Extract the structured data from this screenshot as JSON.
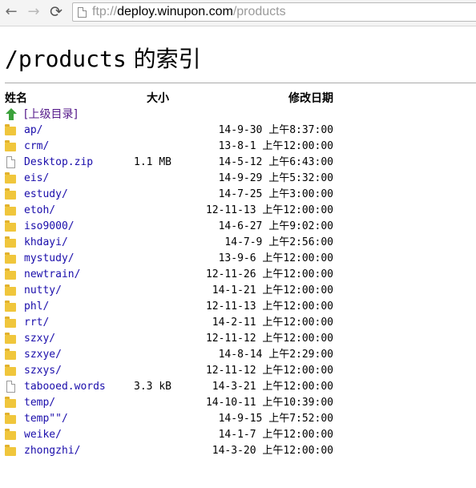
{
  "browser": {
    "back": "←",
    "forward": "→",
    "reload": "⟳",
    "url_scheme": "ftp://",
    "url_host": "deploy.winupon.com",
    "url_path": "/products"
  },
  "page": {
    "title_path": "/products",
    "title_suffix": " 的索引",
    "columns": {
      "name": "姓名",
      "size": "大小",
      "date": "修改日期"
    },
    "parent_label": "[上级目录]",
    "entries": [
      {
        "type": "dir",
        "name": "ap/",
        "size": "",
        "date": "14-9-30 上午8:37:00"
      },
      {
        "type": "dir",
        "name": "crm/",
        "size": "",
        "date": "13-8-1 上午12:00:00"
      },
      {
        "type": "file",
        "name": "Desktop.zip",
        "size": "1.1 MB",
        "date": "14-5-12 上午6:43:00"
      },
      {
        "type": "dir",
        "name": "eis/",
        "size": "",
        "date": "14-9-29 上午5:32:00"
      },
      {
        "type": "dir",
        "name": "estudy/",
        "size": "",
        "date": "14-7-25 上午3:00:00"
      },
      {
        "type": "dir",
        "name": "etoh/",
        "size": "",
        "date": "12-11-13 上午12:00:00"
      },
      {
        "type": "dir",
        "name": "iso9000/",
        "size": "",
        "date": "14-6-27 上午9:02:00"
      },
      {
        "type": "dir",
        "name": "khdayi/",
        "size": "",
        "date": "14-7-9 上午2:56:00"
      },
      {
        "type": "dir",
        "name": "mystudy/",
        "size": "",
        "date": "13-9-6 上午12:00:00"
      },
      {
        "type": "dir",
        "name": "newtrain/",
        "size": "",
        "date": "12-11-26 上午12:00:00"
      },
      {
        "type": "dir",
        "name": "nutty/",
        "size": "",
        "date": "14-1-21 上午12:00:00"
      },
      {
        "type": "dir",
        "name": "phl/",
        "size": "",
        "date": "12-11-13 上午12:00:00"
      },
      {
        "type": "dir",
        "name": "rrt/",
        "size": "",
        "date": "14-2-11 上午12:00:00"
      },
      {
        "type": "dir",
        "name": "szxy/",
        "size": "",
        "date": "12-11-12 上午12:00:00"
      },
      {
        "type": "dir",
        "name": "szxye/",
        "size": "",
        "date": "14-8-14 上午2:29:00"
      },
      {
        "type": "dir",
        "name": "szxys/",
        "size": "",
        "date": "12-11-12 上午12:00:00"
      },
      {
        "type": "file",
        "name": "tabooed.words",
        "size": "3.3 kB",
        "date": "14-3-21 上午12:00:00"
      },
      {
        "type": "dir",
        "name": "temp/",
        "size": "",
        "date": "14-10-11 上午10:39:00"
      },
      {
        "type": "dir",
        "name": "temp\"\"/",
        "size": "",
        "date": "14-9-15 上午7:52:00"
      },
      {
        "type": "dir",
        "name": "weike/",
        "size": "",
        "date": "14-1-7 上午12:00:00"
      },
      {
        "type": "dir",
        "name": "zhongzhi/",
        "size": "",
        "date": "14-3-20 上午12:00:00"
      }
    ]
  }
}
